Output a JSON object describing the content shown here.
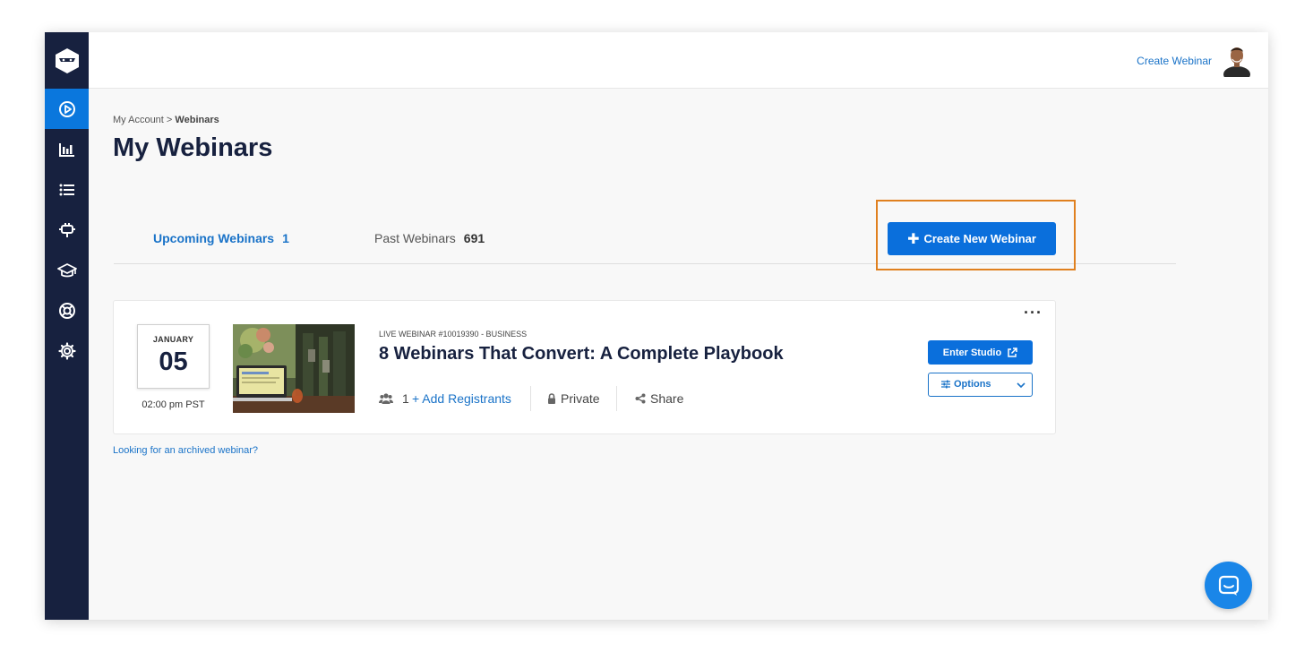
{
  "colors": {
    "sidebar": "#17213f",
    "accent": "#0a6fdc",
    "link": "#1a73c8",
    "highlight": "#e0801f"
  },
  "sidebar": {
    "logo": "ninja-logo-icon",
    "items": [
      {
        "icon": "play-circle-icon",
        "active": true
      },
      {
        "icon": "bar-chart-icon",
        "active": false
      },
      {
        "icon": "list-icon",
        "active": false
      },
      {
        "icon": "plugin-icon",
        "active": false
      },
      {
        "icon": "graduation-cap-icon",
        "active": false
      },
      {
        "icon": "lifebuoy-icon",
        "active": false
      },
      {
        "icon": "gear-icon",
        "active": false
      }
    ]
  },
  "header": {
    "create_link": "Create Webinar",
    "avatar": "user-avatar"
  },
  "breadcrumb": {
    "parent": "My Account",
    "separator": ">",
    "current": "Webinars"
  },
  "page": {
    "title": "My Webinars"
  },
  "tabs": [
    {
      "label": "Upcoming Webinars",
      "count": "1",
      "active": true
    },
    {
      "label": "Past Webinars",
      "count": "691",
      "active": false
    }
  ],
  "create_button": {
    "label": "Create New Webinar",
    "icon": "plus-icon"
  },
  "webinar": {
    "month": "JANUARY",
    "day": "05",
    "time": "02:00 pm PST",
    "type_line": "LIVE WEBINAR #10019390 - BUSINESS",
    "title": "8 Webinars That Convert: A Complete Playbook",
    "registrants": "1",
    "add_registrants": "+ Add Registrants",
    "privacy": "Private",
    "share": "Share",
    "more": "···",
    "enter_studio": "Enter Studio",
    "options": "Options"
  },
  "archived_link": "Looking for an archived webinar?"
}
